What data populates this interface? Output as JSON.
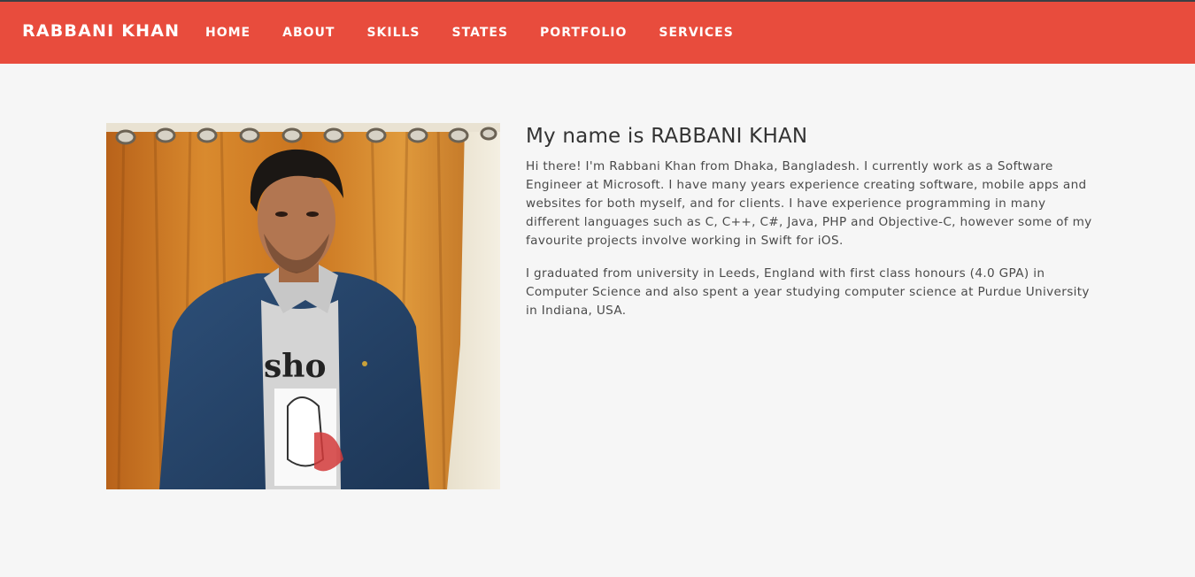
{
  "brand": "RABBANI KHAN",
  "nav": {
    "home": "HOME",
    "about": "ABOUT",
    "skills": "SKILLS",
    "states": "STATES",
    "portfolio": "PORTFOLIO",
    "services": "SERVICES"
  },
  "profile": {
    "tshirt_text": "sho"
  },
  "about": {
    "heading": "My name is RABBANI KHAN",
    "paragraph1": "Hi there! I'm Rabbani Khan from Dhaka, Bangladesh. I currently work as a Software Engineer at Microsoft. I have many years experience creating software, mobile apps and websites for both myself, and for clients. I have experience programming in many different languages such as C, C++, C#, Java, PHP and Objective-C, however some of my favourite projects involve working in Swift for iOS.",
    "paragraph2": "I graduated from university in Leeds, England with first class honours (4.0 GPA) in Computer Science and also spent a year studying computer science at Purdue University in Indiana, USA."
  },
  "colors": {
    "navbar": "#e84c3d",
    "background": "#f6f6f6",
    "topline": "#3a3f44"
  }
}
